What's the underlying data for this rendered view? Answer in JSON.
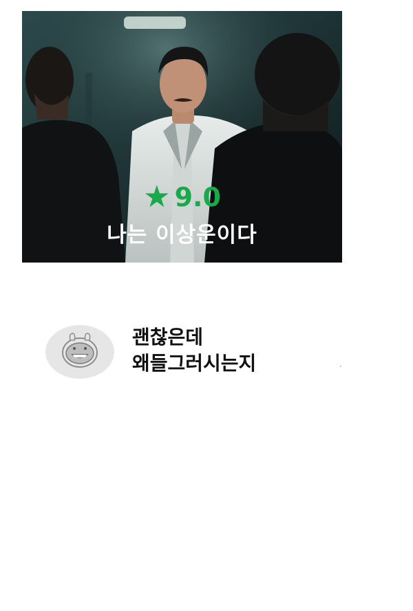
{
  "poster": {
    "rating_star": "★",
    "rating_value": "9.0",
    "title": "나는 이상운이다",
    "rating_color": "#19a84a",
    "image_description_icon": "movie-still-image"
  },
  "comment": {
    "avatar_icon": "rabbit-face-icon",
    "lines": [
      "괜찮은데",
      "왜들그러시는지"
    ]
  }
}
